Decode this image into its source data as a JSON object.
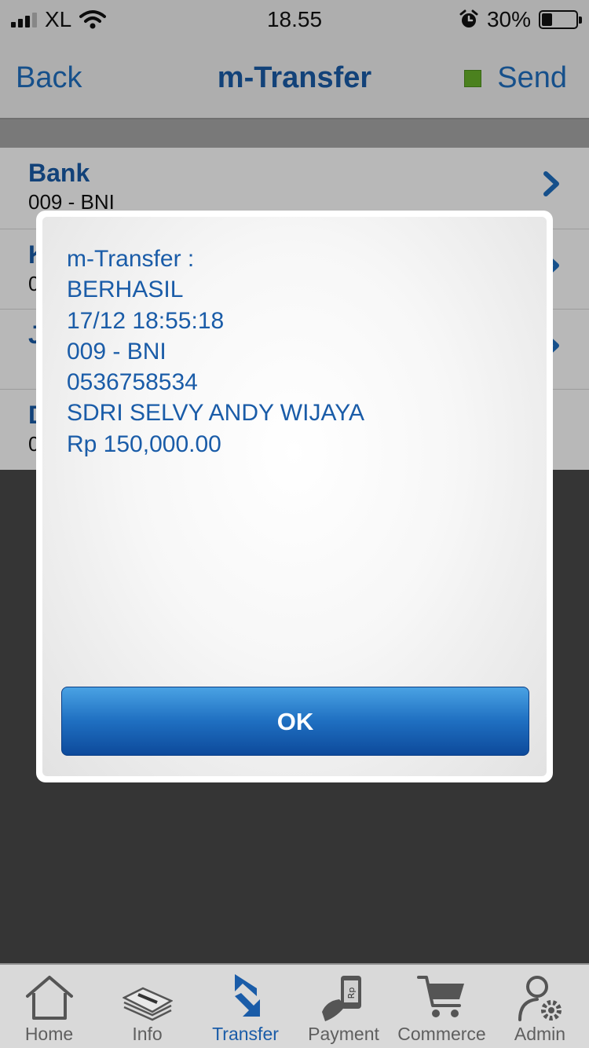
{
  "status_bar": {
    "carrier": "XL",
    "time": "18.55",
    "battery_percent": "30%",
    "battery_level": 0.3,
    "signal_bars_active": 3
  },
  "navbar": {
    "back_label": "Back",
    "title": "m-Transfer",
    "send_label": "Send",
    "send_indicator_color": "#68b32a"
  },
  "form": {
    "rows": [
      {
        "label": "Bank",
        "value": "009 - BNI"
      },
      {
        "label": "K",
        "value": "0"
      },
      {
        "label": "J",
        "value": ""
      },
      {
        "label": "D",
        "value": "0"
      }
    ]
  },
  "dialog": {
    "lines": [
      "m-Transfer :",
      "BERHASIL",
      "17/12 18:55:18",
      "009 - BNI",
      "0536758534",
      "SDRI SELVY ANDY WIJAYA",
      "Rp 150,000.00"
    ],
    "ok_label": "OK"
  },
  "tabbar": {
    "items": [
      {
        "label": "Home",
        "icon": "home-icon"
      },
      {
        "label": "Info",
        "icon": "info-icon"
      },
      {
        "label": "Transfer",
        "icon": "transfer-icon",
        "active": true
      },
      {
        "label": "Payment",
        "icon": "payment-icon"
      },
      {
        "label": "Commerce",
        "icon": "cart-icon"
      },
      {
        "label": "Admin",
        "icon": "admin-icon"
      }
    ]
  },
  "colors": {
    "accent": "#1a5ca8",
    "link": "#1f6fc1"
  }
}
